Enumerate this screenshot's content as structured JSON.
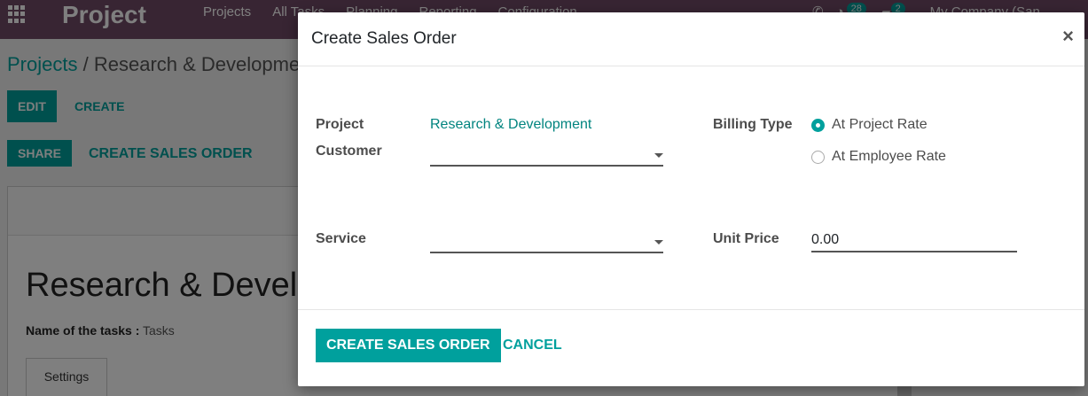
{
  "app": {
    "brand": "Project",
    "menu": [
      "Projects",
      "All Tasks",
      "Planning",
      "Reporting",
      "Configuration"
    ],
    "activity_count": "28",
    "message_count": "2",
    "company": "My Company (San",
    "breadcrumb_root": "Projects",
    "breadcrumb_sep": "/",
    "breadcrumb_current": "Research & Developme",
    "edit_label": "EDIT",
    "create_label": "CREATE",
    "share_label": "SHARE",
    "create_so_label": "CREATE SALES ORDER",
    "record_title": "Research & Develo",
    "tasks_label": "Name of the tasks :",
    "tasks_value": "Tasks",
    "settings_tab": "Settings"
  },
  "dialog": {
    "title": "Create Sales Order",
    "close_symbol": "×",
    "project_label": "Project",
    "project_value": "Research & Development",
    "customer_label": "Customer",
    "customer_value": "",
    "service_label": "Service",
    "service_value": "",
    "billing_type_label": "Billing Type",
    "billing_options": [
      {
        "label": "At Project Rate",
        "selected": true
      },
      {
        "label": "At Employee Rate",
        "selected": false
      }
    ],
    "unit_price_label": "Unit Price",
    "unit_price_value": "0.00",
    "primary_button": "CREATE SALES ORDER",
    "cancel_button": "CANCEL"
  },
  "colors": {
    "brand_purple": "#714b67",
    "accent_teal": "#00a09d",
    "link_teal": "#01847f"
  }
}
